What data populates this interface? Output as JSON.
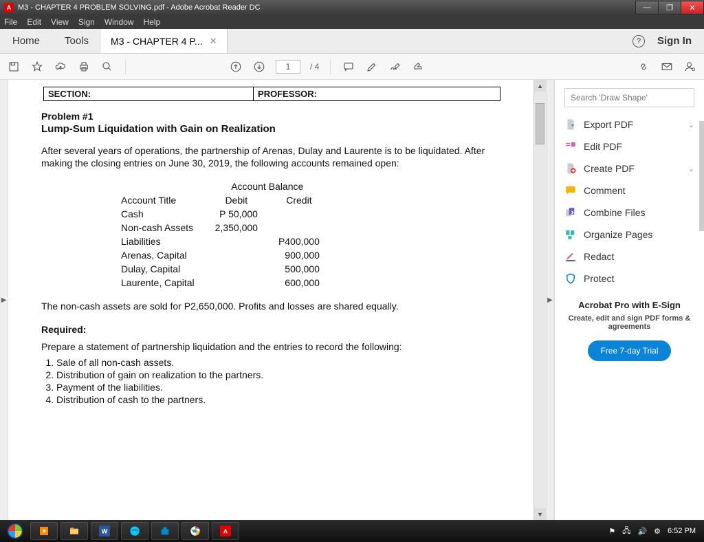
{
  "window": {
    "title": "M3 - CHAPTER 4 PROBLEM SOLVING.pdf - Adobe Acrobat Reader DC"
  },
  "menu": {
    "file": "File",
    "edit": "Edit",
    "view": "View",
    "sign": "Sign",
    "window": "Window",
    "help": "Help"
  },
  "tabbar": {
    "home": "Home",
    "tools": "Tools",
    "doc": "M3 - CHAPTER 4 P...",
    "signin": "Sign In"
  },
  "toolbar": {
    "page_current": "1",
    "page_total": "/ 4"
  },
  "side": {
    "search_placeholder": "Search 'Draw Shape'",
    "items": {
      "export": "Export PDF",
      "edit": "Edit PDF",
      "create": "Create PDF",
      "comment": "Comment",
      "combine": "Combine Files",
      "organize": "Organize Pages",
      "redact": "Redact",
      "protect": "Protect"
    },
    "promo": {
      "title": "Acrobat Pro with E-Sign",
      "subtitle": "Create, edit and sign PDF forms & agreements",
      "cta": "Free 7-day Trial"
    }
  },
  "doc": {
    "box": {
      "section": "SECTION:",
      "professor": "PROFESSOR:"
    },
    "problem_no": "Problem #1",
    "problem_title": "Lump-Sum Liquidation with Gain on Realization",
    "para1": "After several years of operations, the partnership of Arenas, Dulay and Laurente is to be liquidated. After making the closing entries on June 30, 2019, the following accounts remained open:",
    "table": {
      "h_balance": "Account Balance",
      "h_title": "Account Title",
      "h_debit": "Debit",
      "h_credit": "Credit",
      "rows": [
        {
          "t": "Cash",
          "d": "P   50,000",
          "c": ""
        },
        {
          "t": "Non-cash Assets",
          "d": "2,350,000",
          "c": ""
        },
        {
          "t": "Liabilities",
          "d": "",
          "c": "P400,000"
        },
        {
          "t": "Arenas, Capital",
          "d": "",
          "c": "900,000"
        },
        {
          "t": "Dulay, Capital",
          "d": "",
          "c": "500,000"
        },
        {
          "t": "Laurente, Capital",
          "d": "",
          "c": "600,000"
        }
      ]
    },
    "para2": "The non-cash assets are sold for P2,650,000. Profits and losses are shared equally.",
    "required_hdr": "Required:",
    "required_intro": "Prepare a statement of partnership liquidation and the entries to record the following:",
    "req": [
      "Sale of all non-cash assets.",
      "Distribution of gain on realization to the partners.",
      "Payment of the liabilities.",
      "Distribution of cash to the partners."
    ]
  },
  "taskbar": {
    "time": "6:52 PM"
  }
}
